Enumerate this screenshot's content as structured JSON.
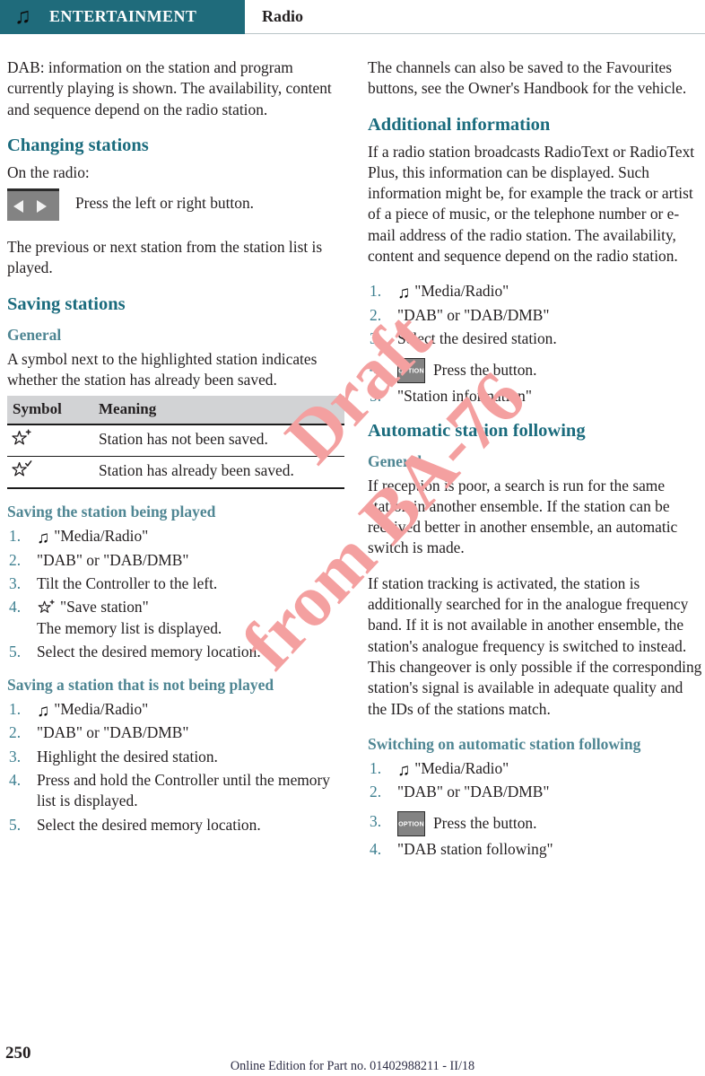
{
  "header": {
    "icon": "music-note-icon",
    "section": "ENTERTAINMENT",
    "topic": "Radio",
    "teal": "#1f6b7b"
  },
  "watermark": {
    "line1": "Draft",
    "line2": "from BA-76",
    "color": "#f4a0a0"
  },
  "left_column": {
    "intro_paragraph": "DAB: information on the station and program currently playing is shown. The availability, content and sequence depend on the radio station.",
    "changing_stations": {
      "heading": "Changing stations",
      "lead": "On the radio:",
      "key_label": "Press the left or right button.",
      "key_icons": [
        "arrow-left-icon",
        "arrow-right-icon"
      ],
      "after": "The previous or next station from the station list is played."
    },
    "saving_stations": {
      "heading": "Saving stations",
      "general_heading": "General",
      "general_text": "A symbol next to the highlighted station indicates whether the station has already been saved.",
      "table": {
        "columns": [
          "Symbol",
          "Meaning"
        ],
        "rows": [
          {
            "symbol": "star-plus-icon",
            "meaning": "Station has not been saved."
          },
          {
            "symbol": "star-check-icon",
            "meaning": "Station has already been saved."
          }
        ]
      }
    },
    "saving_played": {
      "heading": "Saving the station being played",
      "steps": [
        {
          "num": "1.",
          "icon": "music-note-icon",
          "text": "\"Media/Radio\""
        },
        {
          "num": "2.",
          "icon": null,
          "text": "\"DAB\" or \"DAB/DMB\""
        },
        {
          "num": "3.",
          "icon": null,
          "text": "Tilt the Controller to the left."
        },
        {
          "num": "4.",
          "icon": "star-plus-icon",
          "text": "\"Save station\"",
          "sub": "The memory list is displayed."
        },
        {
          "num": "5.",
          "icon": null,
          "text": "Select the desired memory location."
        }
      ]
    },
    "saving_not_played": {
      "heading": "Saving a station that is not being played",
      "steps": [
        {
          "num": "1.",
          "icon": "music-note-icon",
          "text": "\"Media/Radio\""
        },
        {
          "num": "2.",
          "icon": null,
          "text": "\"DAB\" or \"DAB/DMB\""
        },
        {
          "num": "3.",
          "icon": null,
          "text": "Highlight the desired station."
        },
        {
          "num": "4.",
          "icon": null,
          "text": "Press and hold the Controller until the memory list is displayed."
        },
        {
          "num": "5.",
          "icon": null,
          "text": "Select the desired memory location."
        }
      ]
    }
  },
  "right_column": {
    "favourites_paragraph": "The channels can also be saved to the Favourites buttons, see the Owner's Handbook for the vehicle.",
    "additional_information": {
      "heading": "Additional information",
      "text": "If a radio station broadcasts RadioText or RadioText Plus, this information can be displayed. Such information might be, for example the track or artist of a piece of music, or the telephone number or e-mail address of the radio station. The availability, content and sequence depend on the radio station.",
      "steps": [
        {
          "num": "1.",
          "icon": "music-note-icon",
          "text": "\"Media/Radio\""
        },
        {
          "num": "2.",
          "icon": null,
          "text": "\"DAB\" or \"DAB/DMB\""
        },
        {
          "num": "3.",
          "icon": null,
          "text": "Select the desired station."
        },
        {
          "num": "4.",
          "icon": "option-key-icon",
          "text": "Press the button."
        },
        {
          "num": "5.",
          "icon": null,
          "text": "\"Station information\""
        }
      ]
    },
    "automatic_station_following": {
      "heading": "Automatic station following",
      "general_heading": "General",
      "paragraph1": "If reception is poor, a search is run for the same station in another ensemble. If the station can be received better in another ensemble, an automatic switch is made.",
      "paragraph2": "If station tracking is activated, the station is additionally searched for in the analogue frequency band. If it is not available in another ensemble, the station's analogue frequency is switched to instead. This changeover is only possible if the corresponding station's signal is available in adequate quality and the IDs of the stations match."
    },
    "switching_on": {
      "heading": "Switching on automatic station following",
      "steps": [
        {
          "num": "1.",
          "icon": "music-note-icon",
          "text": "\"Media/Radio\""
        },
        {
          "num": "2.",
          "icon": null,
          "text": "\"DAB\" or \"DAB/DMB\""
        },
        {
          "num": "3.",
          "icon": "option-key-icon",
          "text": "Press the button."
        },
        {
          "num": "4.",
          "icon": null,
          "text": "\"DAB station following\""
        }
      ]
    }
  },
  "footer": {
    "page_number": "250",
    "edition": "Online Edition for Part no. 01402988211 - II/18"
  },
  "icons": {
    "music_note": "♫",
    "option_label": "OPTION"
  }
}
